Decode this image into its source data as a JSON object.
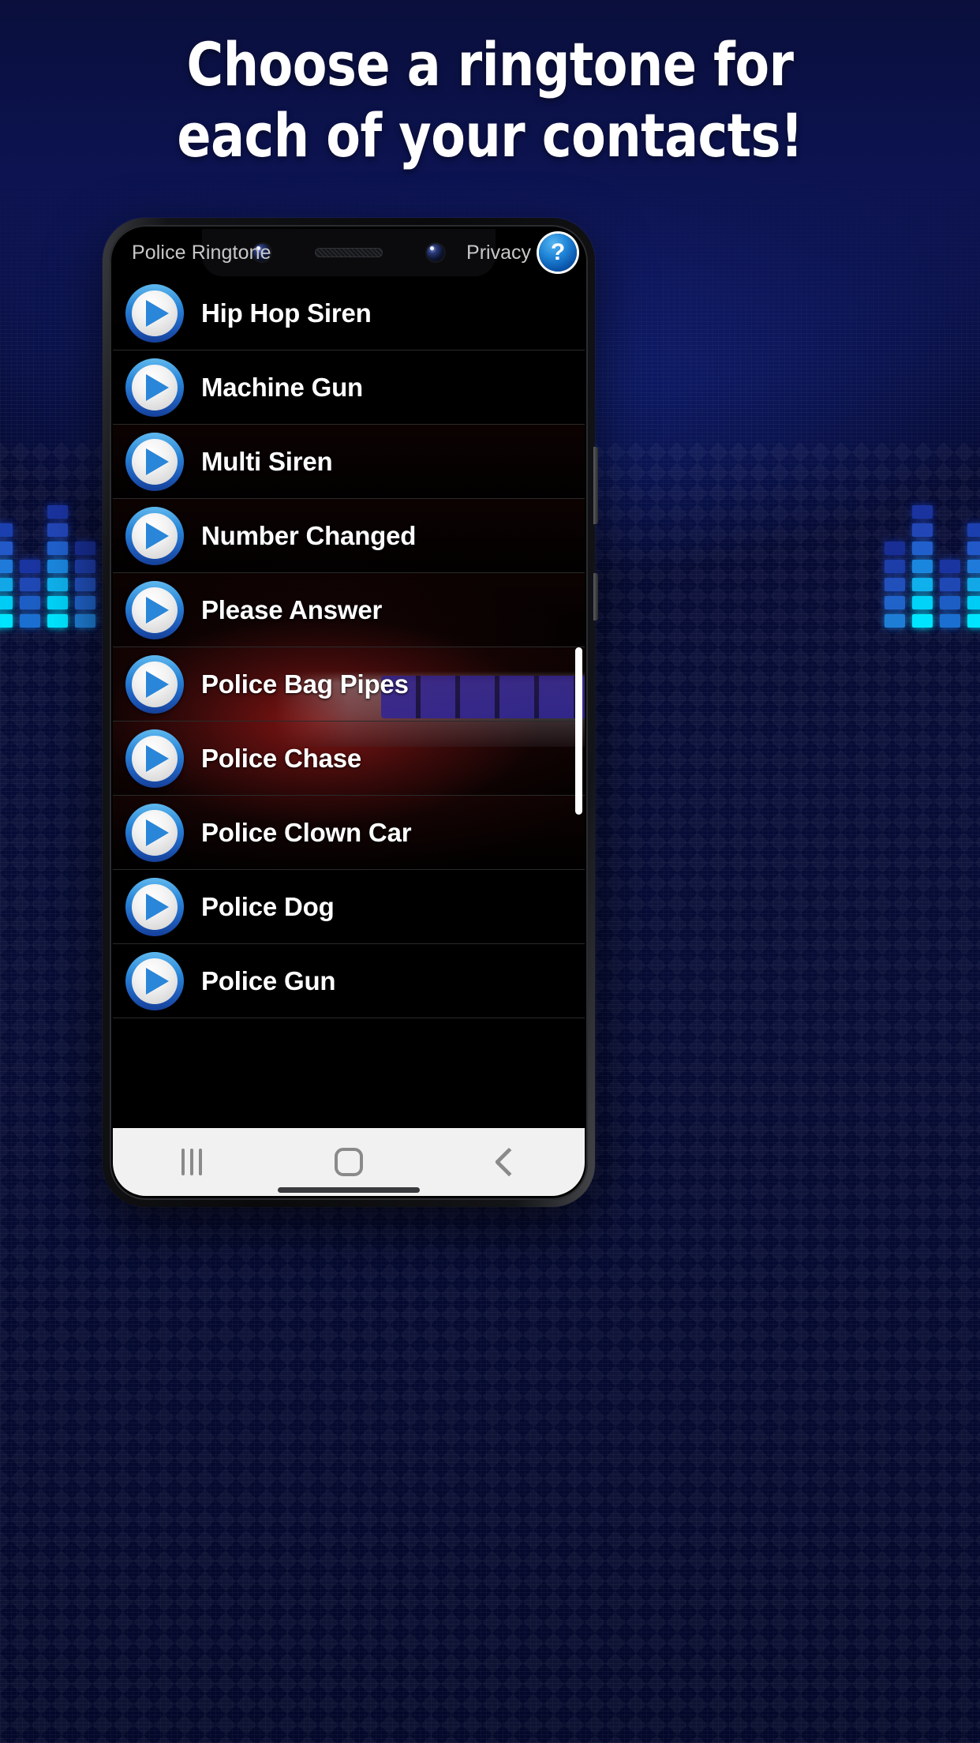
{
  "headline": {
    "line1": "Choose a ringtone for",
    "line2": "each of your contacts!"
  },
  "phone": {
    "app_header": {
      "title": "Police Ringtone",
      "privacy_label": "Privacy",
      "help_glyph": "?"
    },
    "ringtones": [
      {
        "label": "Hip Hop Siren"
      },
      {
        "label": "Machine Gun"
      },
      {
        "label": "Multi Siren"
      },
      {
        "label": "Number Changed"
      },
      {
        "label": "Please Answer"
      },
      {
        "label": "Police Bag Pipes"
      },
      {
        "label": "Police Chase"
      },
      {
        "label": "Police Clown Car"
      },
      {
        "label": "Police Dog"
      },
      {
        "label": "Police Gun"
      }
    ],
    "nav_bar": {
      "recents_name": "recents-button",
      "home_name": "home-button",
      "back_name": "back-button"
    }
  },
  "colors": {
    "accent_blue": "#2a86d8",
    "bg_blue": "#1a3cc4",
    "bg_navy": "#0a0f3c",
    "screen_black": "#000000",
    "text_white": "#ffffff",
    "header_gray": "#c8c8c8",
    "divider": "#2a2a2a",
    "navbar_bg": "#f1f1f1",
    "navbar_icon": "#8a8a8a",
    "glow_red": "#961816",
    "scrollbar": "#ffffff"
  },
  "equalizer": {
    "left": [
      {
        "segments": 6,
        "colors": [
          "#00e5ff",
          "#00cdf5",
          "#12a8e8",
          "#1f7ada",
          "#2358c8",
          "#1b3fae"
        ]
      },
      {
        "segments": 4,
        "colors": [
          "#1b6fd0",
          "#1d5ec4",
          "#2048b4",
          "#1a35a0"
        ]
      },
      {
        "segments": 7,
        "colors": [
          "#00e5ff",
          "#00d2f8",
          "#0fb0ec",
          "#1b86de",
          "#2160cc",
          "#2246b6",
          "#1a339e"
        ]
      },
      {
        "segments": 5,
        "colors": [
          "#1e7ed6",
          "#2063c9",
          "#2150bb",
          "#1d3da8",
          "#182e94"
        ]
      }
    ],
    "right": [
      {
        "segments": 5,
        "colors": [
          "#1e7ed6",
          "#2063c9",
          "#2150bb",
          "#1d3da8",
          "#182e94"
        ]
      },
      {
        "segments": 7,
        "colors": [
          "#00e5ff",
          "#00d2f8",
          "#0fb0ec",
          "#1b86de",
          "#2160cc",
          "#2246b6",
          "#1a339e"
        ]
      },
      {
        "segments": 4,
        "colors": [
          "#1b6fd0",
          "#1d5ec4",
          "#2048b4",
          "#1a35a0"
        ]
      },
      {
        "segments": 6,
        "colors": [
          "#00e5ff",
          "#00cdf5",
          "#12a8e8",
          "#1f7ada",
          "#2358c8",
          "#1b3fae"
        ]
      }
    ]
  }
}
